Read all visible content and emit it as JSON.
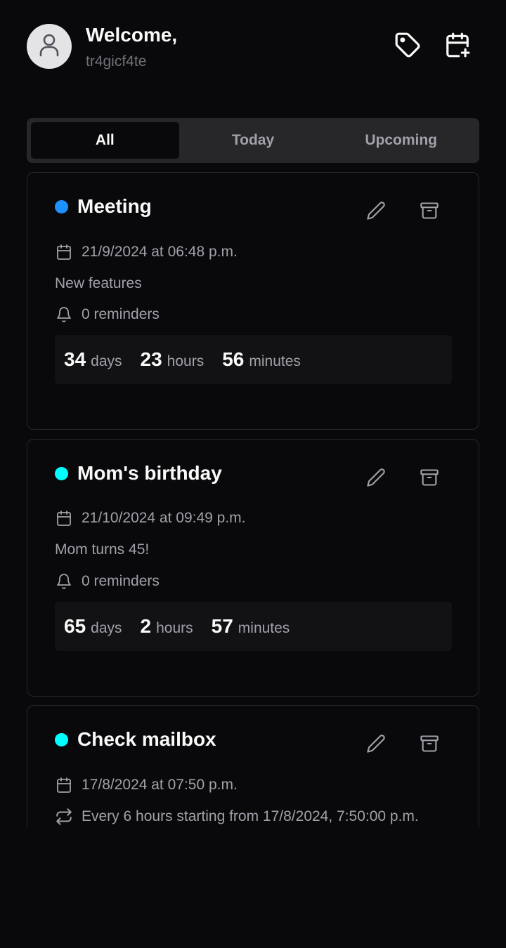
{
  "header": {
    "welcome": "Welcome,",
    "username": "tr4gicf4te",
    "icons": [
      "user-icon",
      "tag-icon",
      "calendar-plus-icon"
    ]
  },
  "tabs": [
    {
      "label": "All",
      "active": true
    },
    {
      "label": "Today",
      "active": false
    },
    {
      "label": "Upcoming",
      "active": false
    }
  ],
  "events": [
    {
      "title": "Meeting",
      "color": "#1e90ff",
      "date": "21/9/2024 at 06:48 p.m.",
      "description": "New features",
      "reminders": "0 reminders",
      "countdown": {
        "days": "34",
        "days_label": "days",
        "hours": "23",
        "hours_label": "hours",
        "minutes": "56",
        "minutes_label": "minutes"
      }
    },
    {
      "title": "Mom's birthday",
      "color": "#00ffff",
      "date": "21/10/2024 at 09:49 p.m.",
      "description": "Mom turns 45!",
      "reminders": "0 reminders",
      "countdown": {
        "days": "65",
        "days_label": "days",
        "hours": "2",
        "hours_label": "hours",
        "minutes": "57",
        "minutes_label": "minutes"
      }
    },
    {
      "title": "Check mailbox",
      "color": "#00ffff",
      "date": "17/8/2024 at 07:50 p.m.",
      "recurrence": "Every 6 hours starting from 17/8/2024, 7:50:00 p.m."
    }
  ],
  "colors": {
    "background": "#09090b",
    "tabs_bg": "#27272a",
    "muted_text": "#a1a1aa"
  }
}
